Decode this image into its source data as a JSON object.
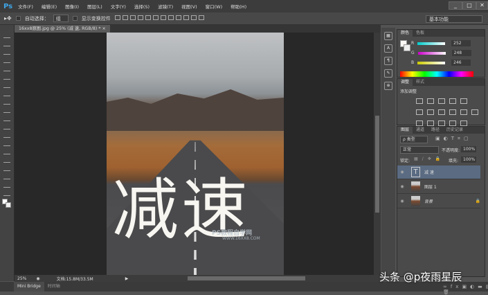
{
  "app": {
    "logo": "Ps",
    "menu": [
      "文件(F)",
      "编辑(E)",
      "图像(I)",
      "图层(L)",
      "文字(Y)",
      "选择(S)",
      "滤镜(T)",
      "视图(V)",
      "窗口(W)",
      "帮助(H)"
    ],
    "window_buttons": [
      "_",
      "□",
      "✕"
    ]
  },
  "options": {
    "auto_select_label": "自动选择：",
    "auto_select_value": "组",
    "show_transform_label": "显示变换控件",
    "workspace": "基本功能"
  },
  "document": {
    "tab_title": "16xx8原图.jpg @ 25% (减 速, RGB/8) *",
    "close": "×",
    "big_text": "减速",
    "watermark": "PS教程自学网",
    "watermark_url": "WWW.16XX8.COM"
  },
  "status": {
    "zoom": "25%",
    "doc_size": "文档:15.8M/33.5M"
  },
  "bottom_tabs": [
    "Mini Bridge",
    "时间轴"
  ],
  "color_panel": {
    "tabs": [
      "颜色",
      "色板"
    ],
    "r_label": "R",
    "g_label": "G",
    "b_label": "B",
    "r": "252",
    "g": "248",
    "b": "246"
  },
  "adjust_panel": {
    "tabs": [
      "调整",
      "样式"
    ],
    "title": "添加调整"
  },
  "layers_panel": {
    "tabs": [
      "图层",
      "通道",
      "路径",
      "历史记录"
    ],
    "filter": "ρ 类型",
    "blend": "正常",
    "opacity_label": "不透明度:",
    "opacity": "100%",
    "lock_label": "锁定:",
    "fill_label": "填充:",
    "fill": "100%",
    "layers": [
      {
        "name": "减 速",
        "type": "text"
      },
      {
        "name": "图层 1",
        "type": "image"
      },
      {
        "name": "背景",
        "type": "image",
        "locked": true
      }
    ]
  },
  "credit": "头条 @p夜雨星辰"
}
